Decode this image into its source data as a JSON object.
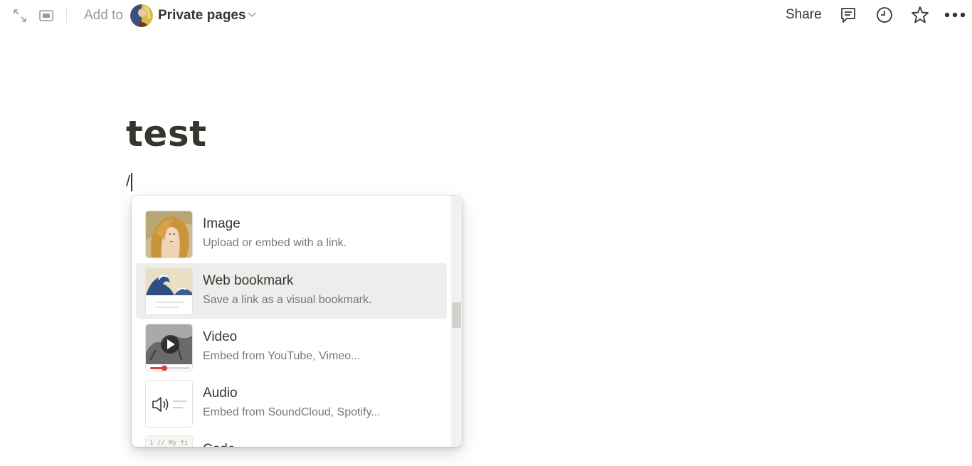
{
  "topbar": {
    "add_to_label": "Add to",
    "workspace_name": "Private pages",
    "share_label": "Share"
  },
  "page": {
    "title": "test",
    "editor_text": "/"
  },
  "slash_menu": {
    "items": [
      {
        "title": "Image",
        "description": "Upload or embed with a link.",
        "icon": "image-thumbnail",
        "selected": false
      },
      {
        "title": "Web bookmark",
        "description": "Save a link as a visual bookmark.",
        "icon": "web-bookmark-thumbnail",
        "selected": true
      },
      {
        "title": "Video",
        "description": "Embed from YouTube, Vimeo...",
        "icon": "video-thumbnail",
        "selected": false
      },
      {
        "title": "Audio",
        "description": "Embed from SoundCloud, Spotify...",
        "icon": "audio-thumbnail",
        "selected": false
      },
      {
        "title": "Code",
        "description": "",
        "icon": "code-thumbnail",
        "selected": false
      }
    ]
  },
  "colors": {
    "text": "#37352f",
    "muted": "#9b9a97",
    "selected_bg": "#ededec"
  }
}
